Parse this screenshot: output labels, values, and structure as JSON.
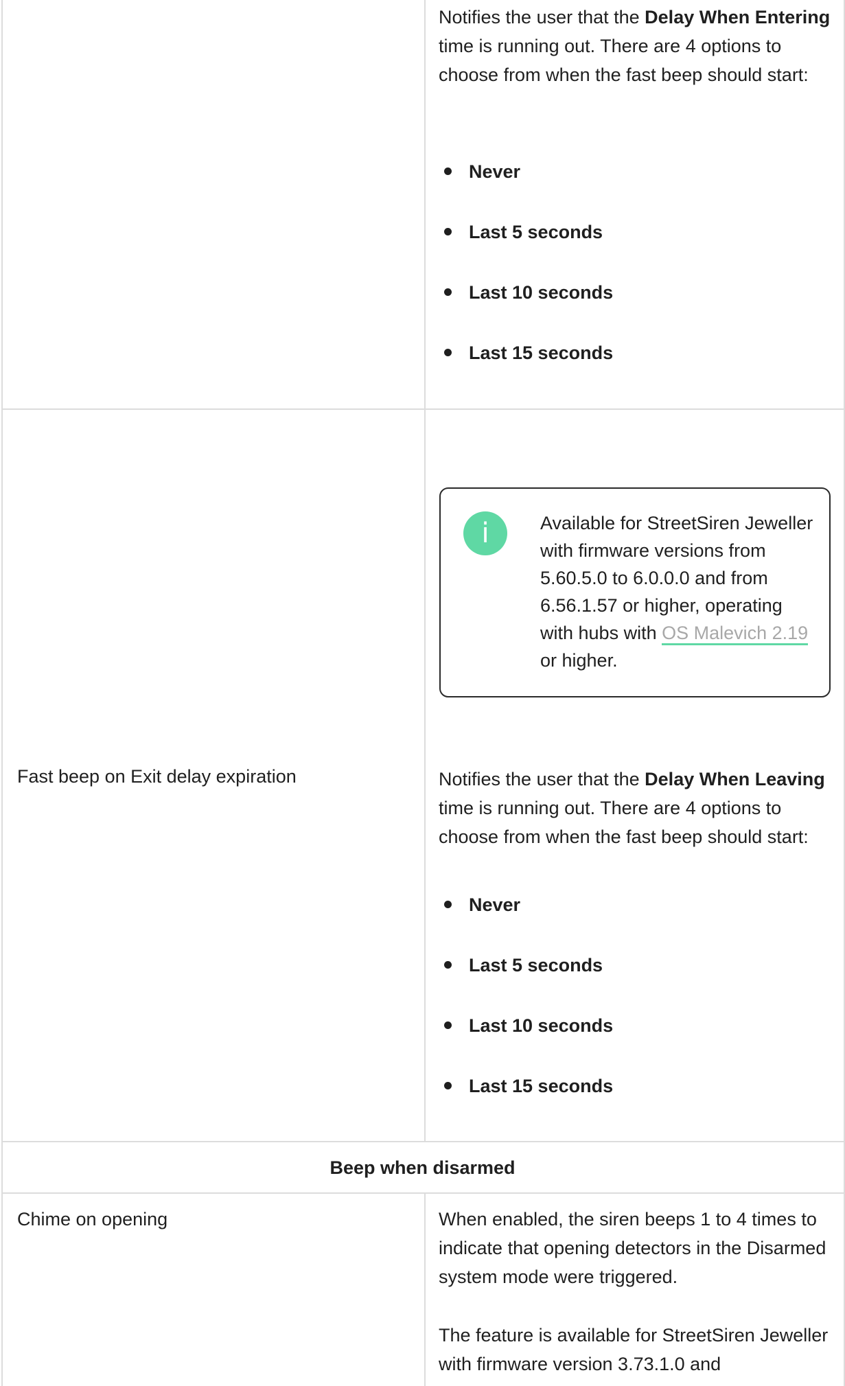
{
  "row1": {
    "description": {
      "prefix": "Notifies the user that the ",
      "bold": "Delay When Entering",
      "suffix": " time is running out. There are 4 options to choose from when the fast beep should start:"
    },
    "options": [
      "Never",
      "Last 5 seconds",
      "Last 10 seconds",
      "Last 15 seconds"
    ]
  },
  "row2": {
    "label": "Fast beep on Exit delay expiration",
    "note": {
      "icon": "info-icon",
      "icon_glyph": "i",
      "text_before": "Available for StreetSiren Jeweller with firmware versions from 5.60.5.0 to 6.0.0.0 and from 6.56.1.57 or higher, operating with hubs with ",
      "link": "OS Malevich 2.19",
      "text_after": " or higher."
    },
    "description": {
      "prefix": "Notifies the user that the ",
      "bold": "Delay When Leaving",
      "suffix": " time is running out. There are 4 options to choose from when the fast beep should start:"
    },
    "options": [
      "Never",
      "Last 5 seconds",
      "Last 10 seconds",
      "Last 15 seconds"
    ]
  },
  "section": {
    "title": "Beep when disarmed"
  },
  "row3": {
    "label": "Chime on opening",
    "paragraph1": "When enabled, the siren beeps 1 to 4 times to indicate that opening detectors in the Disarmed system mode were triggered.",
    "paragraph2": "The feature is available for StreetSiren Jeweller with firmware version 3.73.1.0 and"
  },
  "colors": {
    "accent": "#5fd8a4",
    "border": "#dcdcdc",
    "text": "#1f1f1f",
    "link_text": "#a8a8a8"
  }
}
